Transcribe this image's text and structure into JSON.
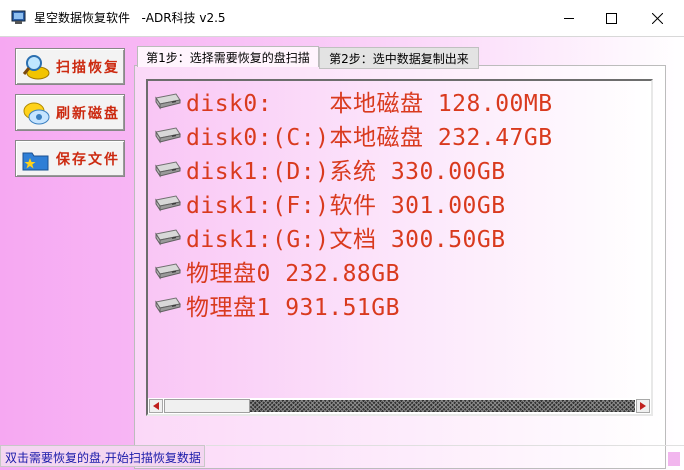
{
  "window": {
    "title": "星空数据恢复软件   -ADR科技 v2.5",
    "minimize_glyph": "—",
    "maximize_glyph": "☐",
    "close_glyph": "✕"
  },
  "sidebar": {
    "buttons": [
      {
        "label": "扫描恢复",
        "icon": "magnifier-disk-icon"
      },
      {
        "label": "刷新磁盘",
        "icon": "refresh-disk-icon"
      },
      {
        "label": "保存文件",
        "icon": "save-folder-icon"
      }
    ]
  },
  "tabs": [
    {
      "label": "第1步：选择需要恢复的盘扫描",
      "active": true
    },
    {
      "label": "第2步：选中数据复制出来",
      "active": false
    }
  ],
  "disk_list": [
    {
      "text": "disk0:    本地磁盘 128.00MB",
      "icon": "drive-icon"
    },
    {
      "text": "disk0:(C:)本地磁盘 232.47GB",
      "icon": "drive-icon"
    },
    {
      "text": "disk1:(D:)系统 330.00GB",
      "icon": "drive-icon"
    },
    {
      "text": "disk1:(F:)软件 301.00GB",
      "icon": "drive-icon"
    },
    {
      "text": "disk1:(G:)文档 300.50GB",
      "icon": "drive-icon"
    },
    {
      "text": "物理盘0 232.88GB",
      "icon": "drive-icon"
    },
    {
      "text": "物理盘1 931.51GB",
      "icon": "drive-icon"
    }
  ],
  "status": {
    "text": "双击需要恢复的盘,开始扫描恢复数据"
  },
  "colors": {
    "accent_text": "#d93a1e",
    "button_text": "#cc2a10",
    "status_text": "#1a1aaa",
    "background_pink": "#f6a8f2"
  }
}
